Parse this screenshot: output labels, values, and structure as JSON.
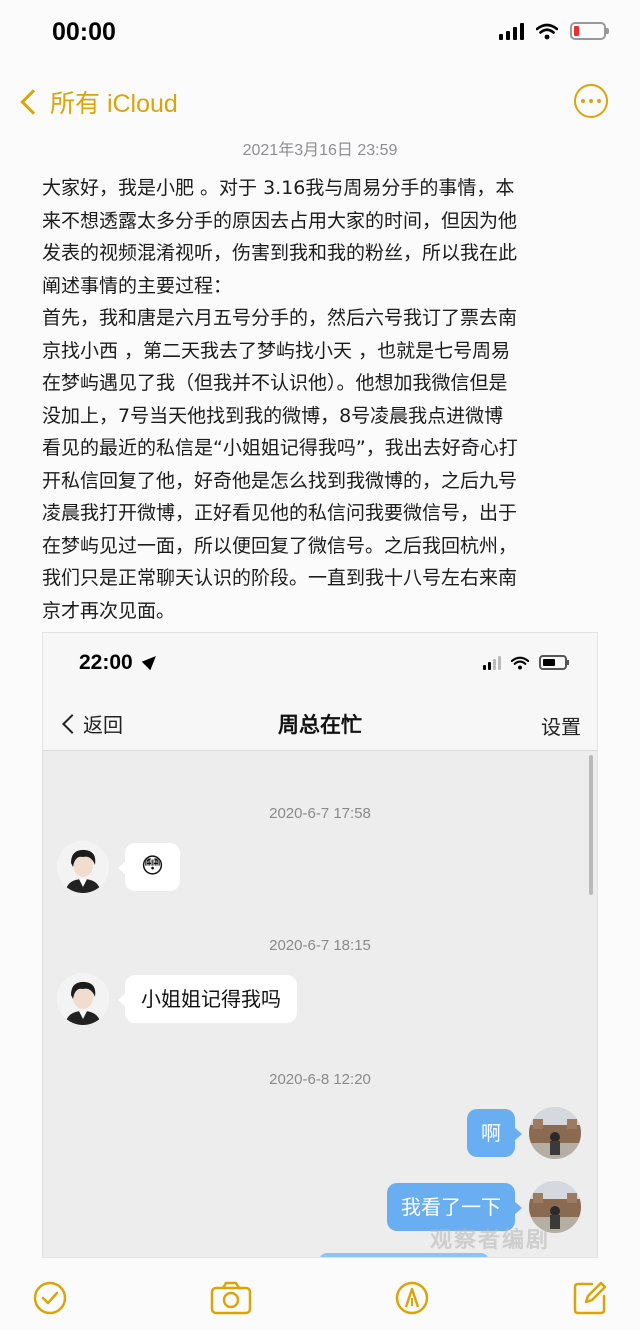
{
  "status_bar": {
    "time": "00:00"
  },
  "nav": {
    "back_label": "所有 iCloud"
  },
  "note": {
    "date": "2021年3月16日 23:59",
    "lines": [
      "大家好，我是小肥 。对于 3.16我与周易分手的事情，本",
      "来不想透露太多分手的原因去占用大家的时间，但因为他",
      "发表的视频混淆视听，伤害到我和我的粉丝，所以我在此",
      "阐述事情的主要过程：",
      "首先，我和唐是六月五号分手的，然后六号我订了票去南",
      "京找小西 ，第二天我去了梦屿找小天 ，也就是七号周易",
      "在梦屿遇见了我（但我并不认识他）。他想加我微信但是",
      "没加上，7号当天他找到我的微博，8号凌晨我点进微博",
      "看见的最近的私信是“小姐姐记得我吗”，我出去好奇心打",
      "开私信回复了他，好奇他是怎么找到我微博的，之后九号",
      "凌晨我打开微博，正好看见他的私信问我要微信号，出于",
      "在梦屿见过一面，所以便回复了微信号。之后我回杭州，",
      "我们只是正常聊天认识的阶段。一直到我十八号左右来南",
      "京才再次见面。"
    ]
  },
  "embed": {
    "status_time": "22:00",
    "back_label": "返回",
    "title": "周总在忙",
    "settings_label": "设置",
    "messages": [
      {
        "timestamp": "2020-6-7 17:58",
        "text": "😳"
      },
      {
        "timestamp": "2020-6-7 18:15",
        "text": "小姐姐记得我吗"
      },
      {
        "timestamp": "2020-6-8 12:20",
        "text": "啊"
      },
      {
        "text": "我看了一下"
      }
    ]
  },
  "watermark": "观察者编剧",
  "icons": {
    "checklist": "checkmark-circle-icon",
    "camera": "camera-icon",
    "markup": "pen-tip-icon",
    "compose": "compose-icon"
  },
  "colors": {
    "accent": "#d9a50b",
    "bubble_out": "#6aaef2",
    "battery_low": "#e5312c"
  }
}
